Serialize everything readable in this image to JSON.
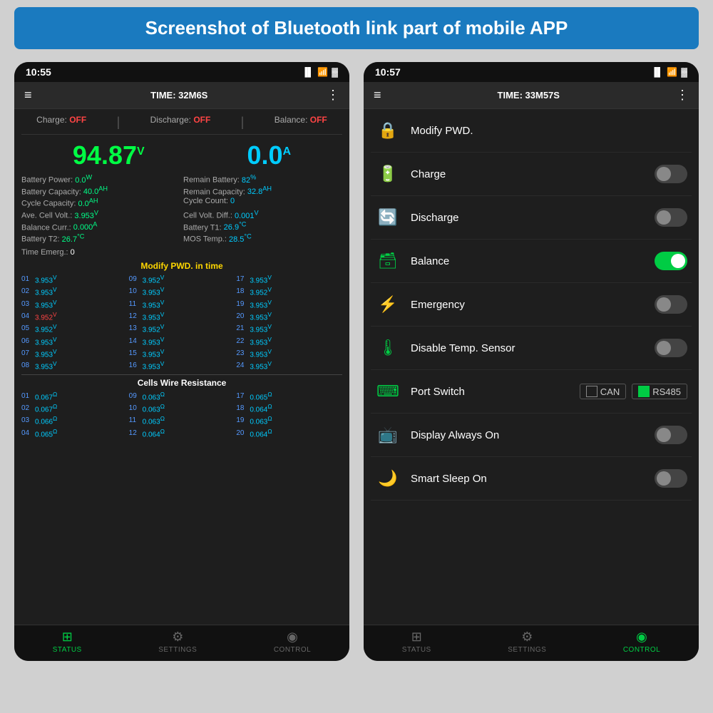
{
  "page": {
    "header": "Screenshot of Bluetooth link part of mobile APP",
    "bg_color": "#d0d0d0",
    "accent_blue": "#1a7abf"
  },
  "phone_left": {
    "statusbar": {
      "time": "10:55",
      "signal": "▐▌",
      "wifi": "WiFi",
      "battery": "🔋"
    },
    "toolbar": {
      "menu": "≡",
      "title": "TIME: 32M6S",
      "dots": "⋮"
    },
    "status_row": [
      {
        "label": "Charge:",
        "value": "OFF"
      },
      {
        "label": "Discharge:",
        "value": "OFF"
      },
      {
        "label": "Balance:",
        "value": "OFF"
      }
    ],
    "big_voltage": "94.87",
    "big_voltage_unit": "V",
    "big_current": "0.0",
    "big_current_unit": "A",
    "metrics": [
      {
        "label": "Battery Power:",
        "value": "0.0",
        "unit": "W",
        "side": "left"
      },
      {
        "label": "Remain Battery:",
        "value": "82",
        "unit": "%",
        "side": "right"
      },
      {
        "label": "Battery Capacity:",
        "value": "40.0",
        "unit": "AH",
        "side": "left"
      },
      {
        "label": "Remain Capacity:",
        "value": "32.8",
        "unit": "AH",
        "side": "right"
      },
      {
        "label": "Cycle Capacity:",
        "value": "0.0",
        "unit": "AH",
        "side": "left"
      },
      {
        "label": "Cycle Count:",
        "value": "0",
        "unit": "",
        "side": "right"
      },
      {
        "label": "Ave. Cell Volt.:",
        "value": "3.953",
        "unit": "V",
        "side": "left"
      },
      {
        "label": "Cell Volt. Diff.:",
        "value": "0.001",
        "unit": "V",
        "side": "right"
      },
      {
        "label": "Balance Curr.:",
        "value": "0.000",
        "unit": "A",
        "side": "left"
      },
      {
        "label": "Battery T1:",
        "value": "26.9",
        "unit": "°C",
        "side": "right"
      },
      {
        "label": "Battery T2:",
        "value": "26.7",
        "unit": "°C",
        "side": "left"
      },
      {
        "label": "MOS Temp.:",
        "value": "28.5",
        "unit": "°C",
        "side": "right"
      }
    ],
    "time_emerg_label": "Time Emerg.:",
    "time_emerg_value": "0",
    "modify_title": "Modify PWD. in time",
    "cells": [
      {
        "num": "01",
        "val": "3.953",
        "unit": "V",
        "red": false
      },
      {
        "num": "09",
        "val": "3.952",
        "unit": "V",
        "red": false
      },
      {
        "num": "17",
        "val": "3.953",
        "unit": "V",
        "red": false
      },
      {
        "num": "02",
        "val": "3.953",
        "unit": "V",
        "red": false
      },
      {
        "num": "10",
        "val": "3.953",
        "unit": "V",
        "red": false
      },
      {
        "num": "18",
        "val": "3.952",
        "unit": "V",
        "red": false
      },
      {
        "num": "03",
        "val": "3.953",
        "unit": "V",
        "red": false
      },
      {
        "num": "11",
        "val": "3.953",
        "unit": "V",
        "red": false
      },
      {
        "num": "19",
        "val": "3.953",
        "unit": "V",
        "red": false
      },
      {
        "num": "04",
        "val": "3.952",
        "unit": "V",
        "red": true
      },
      {
        "num": "12",
        "val": "3.953",
        "unit": "V",
        "red": false
      },
      {
        "num": "20",
        "val": "3.953",
        "unit": "V",
        "red": false
      },
      {
        "num": "05",
        "val": "3.952",
        "unit": "V",
        "red": false
      },
      {
        "num": "13",
        "val": "3.952",
        "unit": "V",
        "red": false
      },
      {
        "num": "21",
        "val": "3.953",
        "unit": "V",
        "red": false
      },
      {
        "num": "06",
        "val": "3.953",
        "unit": "V",
        "red": false
      },
      {
        "num": "14",
        "val": "3.953",
        "unit": "V",
        "red": false
      },
      {
        "num": "22",
        "val": "3.953",
        "unit": "V",
        "red": false
      },
      {
        "num": "07",
        "val": "3.953",
        "unit": "V",
        "red": false
      },
      {
        "num": "15",
        "val": "3.953",
        "unit": "V",
        "red": false
      },
      {
        "num": "23",
        "val": "3.953",
        "unit": "V",
        "red": false
      },
      {
        "num": "08",
        "val": "3.953",
        "unit": "V",
        "red": false
      },
      {
        "num": "16",
        "val": "3.953",
        "unit": "V",
        "red": false
      },
      {
        "num": "24",
        "val": "3.953",
        "unit": "V",
        "red": false
      }
    ],
    "resistance_title": "Cells Wire Resistance",
    "resistance": [
      {
        "num": "01",
        "val": "0.067",
        "unit": "Ω"
      },
      {
        "num": "09",
        "val": "0.063",
        "unit": "Ω"
      },
      {
        "num": "17",
        "val": "0.065",
        "unit": "Ω"
      },
      {
        "num": "02",
        "val": "0.067",
        "unit": "Ω"
      },
      {
        "num": "10",
        "val": "0.063",
        "unit": "Ω"
      },
      {
        "num": "18",
        "val": "0.064",
        "unit": "Ω"
      },
      {
        "num": "03",
        "val": "0.066",
        "unit": "Ω"
      },
      {
        "num": "11",
        "val": "0.063",
        "unit": "Ω"
      },
      {
        "num": "19",
        "val": "0.063",
        "unit": "Ω"
      },
      {
        "num": "04",
        "val": "0.065",
        "unit": "Ω"
      },
      {
        "num": "12",
        "val": "0.064",
        "unit": "Ω"
      },
      {
        "num": "20",
        "val": "0.064",
        "unit": "Ω"
      }
    ],
    "bottom_nav": [
      {
        "label": "STATUS",
        "icon": "⊞",
        "active": true
      },
      {
        "label": "SETTINGS",
        "icon": "⚙",
        "active": false
      },
      {
        "label": "CONTROL",
        "icon": "◉",
        "active": false
      }
    ]
  },
  "phone_right": {
    "statusbar": {
      "time": "10:57"
    },
    "toolbar": {
      "menu": "≡",
      "title": "TIME: 33M57S",
      "dots": "⋮"
    },
    "controls": [
      {
        "id": "modify-pwd",
        "icon": "🔒",
        "label": "Modify PWD.",
        "type": "none",
        "on": false
      },
      {
        "id": "charge",
        "icon": "🔋",
        "label": "Charge",
        "type": "toggle",
        "on": false
      },
      {
        "id": "discharge",
        "icon": "🔄",
        "label": "Discharge",
        "type": "toggle",
        "on": false
      },
      {
        "id": "balance",
        "icon": "🗃",
        "label": "Balance",
        "type": "toggle",
        "on": true
      },
      {
        "id": "emergency",
        "icon": "⚡",
        "label": "Emergency",
        "type": "toggle",
        "on": false
      },
      {
        "id": "disable-temp",
        "icon": "🌡",
        "label": "Disable Temp. Sensor",
        "type": "toggle",
        "on": false
      },
      {
        "id": "port-switch",
        "icon": "⌨",
        "label": "Port Switch",
        "type": "port",
        "can": false,
        "rs485": true
      },
      {
        "id": "display-always",
        "icon": "📺",
        "label": "Display Always On",
        "type": "toggle",
        "on": false
      },
      {
        "id": "smart-sleep",
        "icon": "🌙",
        "label": "Smart Sleep On",
        "type": "toggle",
        "on": false
      }
    ],
    "bottom_nav": [
      {
        "label": "STATUS",
        "icon": "⊞",
        "active": false
      },
      {
        "label": "SETTINGS",
        "icon": "⚙",
        "active": false
      },
      {
        "label": "CONTROL",
        "icon": "◉",
        "active": true
      }
    ]
  }
}
